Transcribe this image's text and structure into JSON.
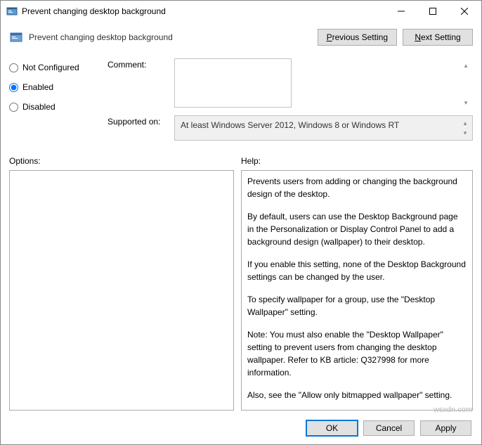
{
  "window": {
    "title": "Prevent changing desktop background"
  },
  "header": {
    "caption": "Prevent changing desktop background",
    "prev": "Previous Setting",
    "next": "Next Setting"
  },
  "state": {
    "not_configured": "Not Configured",
    "enabled": "Enabled",
    "disabled": "Disabled",
    "selected": "enabled"
  },
  "fields": {
    "comment_label": "Comment:",
    "comment_value": "",
    "supported_label": "Supported on:",
    "supported_value": "At least Windows Server 2012, Windows 8 or Windows RT"
  },
  "panels": {
    "options_label": "Options:",
    "help_label": "Help:",
    "help_paragraphs": [
      "Prevents users from adding or changing the background design of the desktop.",
      "By default, users can use the Desktop Background page in the Personalization or Display Control Panel to add a background design (wallpaper) to their desktop.",
      "If you enable this setting, none of the Desktop Background settings can be changed by the user.",
      "To specify wallpaper for a group, use the \"Desktop Wallpaper\" setting.",
      "Note: You must also enable the \"Desktop Wallpaper\" setting to prevent users from changing the desktop wallpaper. Refer to KB article: Q327998 for more information.",
      "Also, see the \"Allow only bitmapped wallpaper\" setting."
    ]
  },
  "buttons": {
    "ok": "OK",
    "cancel": "Cancel",
    "apply": "Apply"
  },
  "watermark": "wsxdn.com"
}
